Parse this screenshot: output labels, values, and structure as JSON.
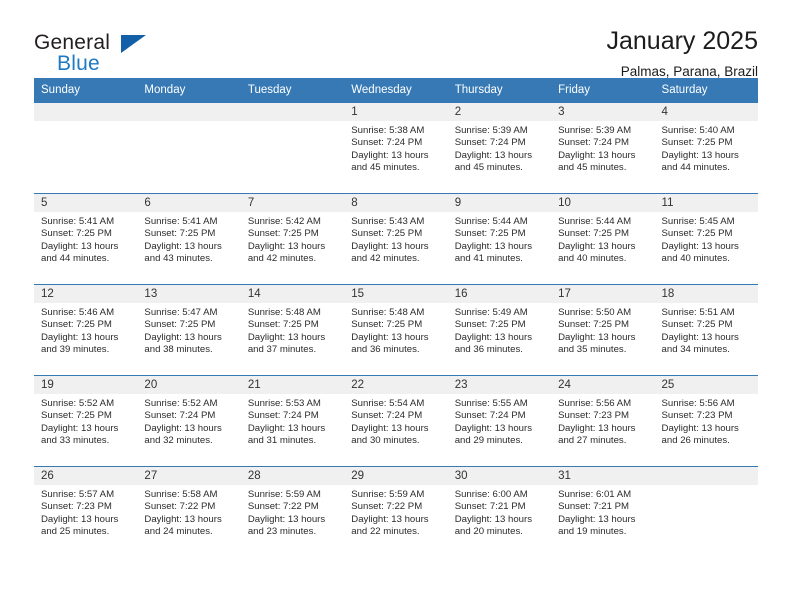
{
  "brand": {
    "name_top": "General",
    "name_bottom": "Blue",
    "triangle_icon": "triangle-icon",
    "accent_color": "#1f7ac4",
    "triangle_color": "#1260a8"
  },
  "header": {
    "title": "January 2025",
    "subtitle": "Palmas, Parana, Brazil"
  },
  "calendar": {
    "header_bg": "#3679b5",
    "header_text_color": "#ffffff",
    "daynum_bg": "#f0f0f0",
    "weekday_headers": [
      "Sunday",
      "Monday",
      "Tuesday",
      "Wednesday",
      "Thursday",
      "Friday",
      "Saturday"
    ],
    "labels": {
      "sunrise": "Sunrise:",
      "sunset": "Sunset:",
      "daylight": "Daylight:"
    },
    "weeks": [
      [
        {
          "day": "",
          "empty": true
        },
        {
          "day": "",
          "empty": true
        },
        {
          "day": "",
          "empty": true
        },
        {
          "day": "1",
          "sunrise": "Sunrise: 5:38 AM",
          "sunset": "Sunset: 7:24 PM",
          "daylight": "Daylight: 13 hours and 45 minutes."
        },
        {
          "day": "2",
          "sunrise": "Sunrise: 5:39 AM",
          "sunset": "Sunset: 7:24 PM",
          "daylight": "Daylight: 13 hours and 45 minutes."
        },
        {
          "day": "3",
          "sunrise": "Sunrise: 5:39 AM",
          "sunset": "Sunset: 7:24 PM",
          "daylight": "Daylight: 13 hours and 45 minutes."
        },
        {
          "day": "4",
          "sunrise": "Sunrise: 5:40 AM",
          "sunset": "Sunset: 7:25 PM",
          "daylight": "Daylight: 13 hours and 44 minutes."
        }
      ],
      [
        {
          "day": "5",
          "sunrise": "Sunrise: 5:41 AM",
          "sunset": "Sunset: 7:25 PM",
          "daylight": "Daylight: 13 hours and 44 minutes."
        },
        {
          "day": "6",
          "sunrise": "Sunrise: 5:41 AM",
          "sunset": "Sunset: 7:25 PM",
          "daylight": "Daylight: 13 hours and 43 minutes."
        },
        {
          "day": "7",
          "sunrise": "Sunrise: 5:42 AM",
          "sunset": "Sunset: 7:25 PM",
          "daylight": "Daylight: 13 hours and 42 minutes."
        },
        {
          "day": "8",
          "sunrise": "Sunrise: 5:43 AM",
          "sunset": "Sunset: 7:25 PM",
          "daylight": "Daylight: 13 hours and 42 minutes."
        },
        {
          "day": "9",
          "sunrise": "Sunrise: 5:44 AM",
          "sunset": "Sunset: 7:25 PM",
          "daylight": "Daylight: 13 hours and 41 minutes."
        },
        {
          "day": "10",
          "sunrise": "Sunrise: 5:44 AM",
          "sunset": "Sunset: 7:25 PM",
          "daylight": "Daylight: 13 hours and 40 minutes."
        },
        {
          "day": "11",
          "sunrise": "Sunrise: 5:45 AM",
          "sunset": "Sunset: 7:25 PM",
          "daylight": "Daylight: 13 hours and 40 minutes."
        }
      ],
      [
        {
          "day": "12",
          "sunrise": "Sunrise: 5:46 AM",
          "sunset": "Sunset: 7:25 PM",
          "daylight": "Daylight: 13 hours and 39 minutes."
        },
        {
          "day": "13",
          "sunrise": "Sunrise: 5:47 AM",
          "sunset": "Sunset: 7:25 PM",
          "daylight": "Daylight: 13 hours and 38 minutes."
        },
        {
          "day": "14",
          "sunrise": "Sunrise: 5:48 AM",
          "sunset": "Sunset: 7:25 PM",
          "daylight": "Daylight: 13 hours and 37 minutes."
        },
        {
          "day": "15",
          "sunrise": "Sunrise: 5:48 AM",
          "sunset": "Sunset: 7:25 PM",
          "daylight": "Daylight: 13 hours and 36 minutes."
        },
        {
          "day": "16",
          "sunrise": "Sunrise: 5:49 AM",
          "sunset": "Sunset: 7:25 PM",
          "daylight": "Daylight: 13 hours and 36 minutes."
        },
        {
          "day": "17",
          "sunrise": "Sunrise: 5:50 AM",
          "sunset": "Sunset: 7:25 PM",
          "daylight": "Daylight: 13 hours and 35 minutes."
        },
        {
          "day": "18",
          "sunrise": "Sunrise: 5:51 AM",
          "sunset": "Sunset: 7:25 PM",
          "daylight": "Daylight: 13 hours and 34 minutes."
        }
      ],
      [
        {
          "day": "19",
          "sunrise": "Sunrise: 5:52 AM",
          "sunset": "Sunset: 7:25 PM",
          "daylight": "Daylight: 13 hours and 33 minutes."
        },
        {
          "day": "20",
          "sunrise": "Sunrise: 5:52 AM",
          "sunset": "Sunset: 7:24 PM",
          "daylight": "Daylight: 13 hours and 32 minutes."
        },
        {
          "day": "21",
          "sunrise": "Sunrise: 5:53 AM",
          "sunset": "Sunset: 7:24 PM",
          "daylight": "Daylight: 13 hours and 31 minutes."
        },
        {
          "day": "22",
          "sunrise": "Sunrise: 5:54 AM",
          "sunset": "Sunset: 7:24 PM",
          "daylight": "Daylight: 13 hours and 30 minutes."
        },
        {
          "day": "23",
          "sunrise": "Sunrise: 5:55 AM",
          "sunset": "Sunset: 7:24 PM",
          "daylight": "Daylight: 13 hours and 29 minutes."
        },
        {
          "day": "24",
          "sunrise": "Sunrise: 5:56 AM",
          "sunset": "Sunset: 7:23 PM",
          "daylight": "Daylight: 13 hours and 27 minutes."
        },
        {
          "day": "25",
          "sunrise": "Sunrise: 5:56 AM",
          "sunset": "Sunset: 7:23 PM",
          "daylight": "Daylight: 13 hours and 26 minutes."
        }
      ],
      [
        {
          "day": "26",
          "sunrise": "Sunrise: 5:57 AM",
          "sunset": "Sunset: 7:23 PM",
          "daylight": "Daylight: 13 hours and 25 minutes."
        },
        {
          "day": "27",
          "sunrise": "Sunrise: 5:58 AM",
          "sunset": "Sunset: 7:22 PM",
          "daylight": "Daylight: 13 hours and 24 minutes."
        },
        {
          "day": "28",
          "sunrise": "Sunrise: 5:59 AM",
          "sunset": "Sunset: 7:22 PM",
          "daylight": "Daylight: 13 hours and 23 minutes."
        },
        {
          "day": "29",
          "sunrise": "Sunrise: 5:59 AM",
          "sunset": "Sunset: 7:22 PM",
          "daylight": "Daylight: 13 hours and 22 minutes."
        },
        {
          "day": "30",
          "sunrise": "Sunrise: 6:00 AM",
          "sunset": "Sunset: 7:21 PM",
          "daylight": "Daylight: 13 hours and 20 minutes."
        },
        {
          "day": "31",
          "sunrise": "Sunrise: 6:01 AM",
          "sunset": "Sunset: 7:21 PM",
          "daylight": "Daylight: 13 hours and 19 minutes."
        },
        {
          "day": "",
          "empty": true
        }
      ]
    ]
  }
}
